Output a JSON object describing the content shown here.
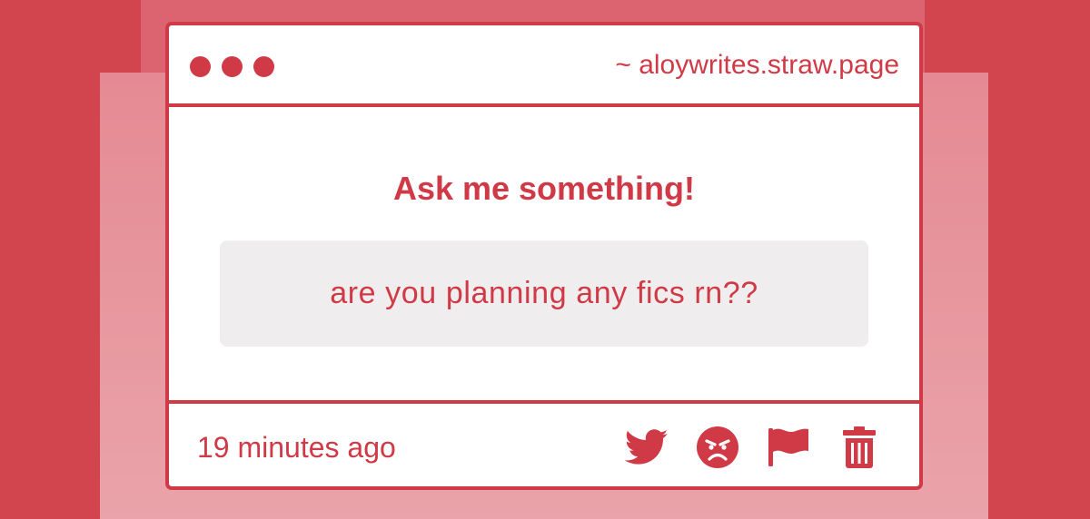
{
  "window": {
    "url": "~ aloywrites.straw.page"
  },
  "main": {
    "title": "Ask me something!",
    "question": "are you planning any fics rn??"
  },
  "footer": {
    "timestamp": "19 minutes ago",
    "actions": [
      {
        "icon": "twitter-icon"
      },
      {
        "icon": "angry-face-icon"
      },
      {
        "icon": "flag-icon"
      },
      {
        "icon": "trash-icon"
      }
    ]
  },
  "colors": {
    "accent": "#d03a46",
    "background": "#d2454e",
    "question_box": "#efeded"
  }
}
